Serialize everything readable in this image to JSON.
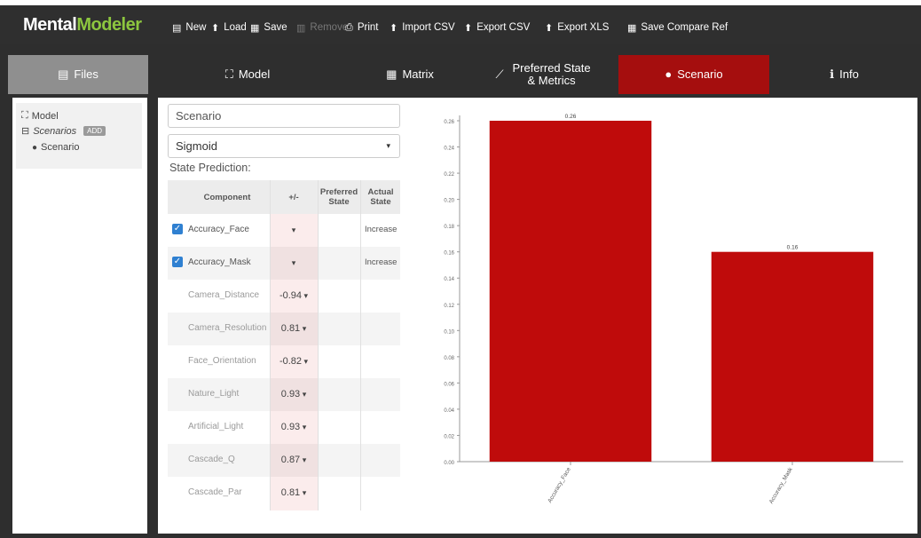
{
  "app": {
    "logo_part1": "Mental",
    "logo_part2": "Modeler"
  },
  "toolbar": [
    {
      "label": "New",
      "icon": "file-icon",
      "glyph": "▤",
      "disabled": false
    },
    {
      "label": "Load",
      "icon": "upload-icon",
      "glyph": "⬆",
      "disabled": false
    },
    {
      "label": "Save",
      "icon": "save-icon",
      "glyph": "▦",
      "disabled": false
    },
    {
      "label": "Remove",
      "icon": "trash-icon",
      "glyph": "▥",
      "disabled": true
    },
    {
      "label": "Print",
      "icon": "print-icon",
      "glyph": "⎙",
      "disabled": false
    },
    {
      "label": "Import CSV",
      "icon": "upload-icon",
      "glyph": "⬆",
      "disabled": false
    },
    {
      "label": "Export CSV",
      "icon": "download-icon",
      "glyph": "⬆",
      "disabled": false
    },
    {
      "label": "Export XLS",
      "icon": "download-icon",
      "glyph": "⬆",
      "disabled": false
    },
    {
      "label": "Save Compare Ref",
      "icon": "save-icon",
      "glyph": "▦",
      "disabled": false
    }
  ],
  "tabs": [
    {
      "label": "Files",
      "icon": "file-icon",
      "glyph": "▤"
    },
    {
      "label": "Model",
      "icon": "sitemap-icon",
      "glyph": "⛶"
    },
    {
      "label": "Matrix",
      "icon": "table-icon",
      "glyph": "▦"
    },
    {
      "label": "Preferred State & Metrics",
      "icon": "line-chart-icon",
      "glyph": "⟋"
    },
    {
      "label": "Scenario",
      "icon": "circle-icon",
      "glyph": "●"
    },
    {
      "label": "Info",
      "icon": "info-icon",
      "glyph": "ℹ"
    }
  ],
  "sidebar": {
    "model_label": "Model",
    "scenarios_label": "Scenarios",
    "add_label": "ADD",
    "scenario_item": "Scenario"
  },
  "scenario": {
    "name_value": "Scenario",
    "function_value": "Sigmoid",
    "state_prediction_label": "State Prediction:"
  },
  "table": {
    "headers": {
      "component": "Component",
      "pm": "+/-",
      "preferred": "Preferred State",
      "actual": "Actual State"
    },
    "rows": [
      {
        "component": "Accuracy_Face",
        "checked": true,
        "pm": "",
        "actual": "Increase"
      },
      {
        "component": "Accuracy_Mask",
        "checked": true,
        "pm": "",
        "actual": "Increase"
      },
      {
        "component": "Camera_Distance",
        "checked": false,
        "pm": "-0.94",
        "actual": ""
      },
      {
        "component": "Camera_Resolution",
        "checked": false,
        "pm": "0.81",
        "actual": ""
      },
      {
        "component": "Face_Orientation",
        "checked": false,
        "pm": "-0.82",
        "actual": ""
      },
      {
        "component": "Nature_Light",
        "checked": false,
        "pm": "0.93",
        "actual": ""
      },
      {
        "component": "Artificial_Light",
        "checked": false,
        "pm": "0.93",
        "actual": ""
      },
      {
        "component": "Cascade_Q",
        "checked": false,
        "pm": "0.87",
        "actual": ""
      },
      {
        "component": "Cascade_Par",
        "checked": false,
        "pm": "0.81",
        "actual": ""
      }
    ]
  },
  "colors": {
    "bar": "#bf0b0b",
    "active_tab": "#a50e0e",
    "files_tab": "#8f8f8f",
    "logo_accent": "#8dc63f"
  },
  "chart_data": {
    "type": "bar",
    "categories": [
      "Accuracy_Face",
      "Accuracy_Mask"
    ],
    "values": [
      0.26,
      0.16
    ],
    "value_labels": [
      "0.26",
      "0.16"
    ],
    "yticks": [
      "0.00",
      "0.02",
      "0.04",
      "0.06",
      "0.08",
      "0.10",
      "0.12",
      "0.14",
      "0.16",
      "0.18",
      "0.20",
      "0.22",
      "0.24",
      "0.26"
    ],
    "ylim": [
      0,
      0.26
    ],
    "grid": false
  }
}
